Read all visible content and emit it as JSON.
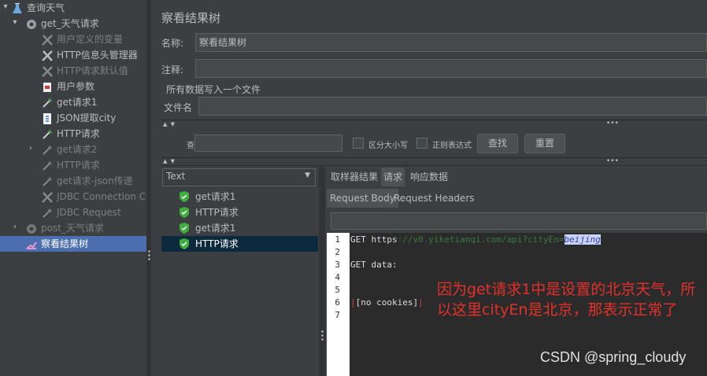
{
  "tree": {
    "items": [
      {
        "label": "查询天气",
        "icon": "flask-icon",
        "disabled": false
      },
      {
        "label": "get_天气请求",
        "icon": "gear-icon",
        "disabled": false
      },
      {
        "label": "用户定义的变量",
        "icon": "wrench-icon",
        "disabled": true
      },
      {
        "label": "HTTP信息头管理器",
        "icon": "wrench-icon",
        "disabled": false
      },
      {
        "label": "HTTP请求默认值",
        "icon": "wrench-icon",
        "disabled": true
      },
      {
        "label": "用户参数",
        "icon": "preprocessor-icon",
        "disabled": false
      },
      {
        "label": "get请求1",
        "icon": "pipette-icon",
        "disabled": false
      },
      {
        "label": "JSON提取city",
        "icon": "extractor-icon",
        "disabled": false
      },
      {
        "label": "HTTP请求",
        "icon": "pipette-icon",
        "disabled": false
      },
      {
        "label": "get请求2",
        "icon": "pipette-icon",
        "disabled": true
      },
      {
        "label": "HTTP请求",
        "icon": "pipette-icon",
        "disabled": true
      },
      {
        "label": "get请求-json传递",
        "icon": "pipette-icon",
        "disabled": true
      },
      {
        "label": "JDBC Connection Co",
        "icon": "wrench-icon",
        "disabled": true
      },
      {
        "label": "JDBC Request",
        "icon": "pipette-icon",
        "disabled": true
      },
      {
        "label": "post_天气请求",
        "icon": "gear-icon",
        "disabled": true
      },
      {
        "label": "察看结果树",
        "icon": "listener-icon",
        "disabled": false
      }
    ]
  },
  "panel": {
    "title": "察看结果树",
    "name_label": "名称:",
    "name_value": "察看结果树",
    "comment_label": "注释:",
    "comment_value": "",
    "write_all_label": "所有数据写入一个文件",
    "filename_label": "文件名",
    "filename_value": "",
    "search_label": "查找:",
    "search_value": "",
    "case_label": "区分大小写",
    "regex_label": "正则表达式",
    "search_button": "查找",
    "reset_button": "重置"
  },
  "results": {
    "renderer": "Text",
    "items": [
      {
        "label": "get请求1"
      },
      {
        "label": "HTTP请求"
      },
      {
        "label": "get请求1"
      },
      {
        "label": "HTTP请求"
      }
    ]
  },
  "tabs": {
    "top": [
      "取样器结果",
      "请求",
      "响应数据"
    ],
    "sub": [
      "Request Body",
      "Request Headers"
    ]
  },
  "code": {
    "line_numbers": [
      "1",
      "2",
      "3",
      "4",
      "5",
      "6",
      "7"
    ],
    "line1_prefix": "GET https",
    "line1_url": "://v0.yiketianqi.com/api?cityEn=",
    "line1_highlight": "beijing",
    "line3": "GET data:",
    "line6": "[no cookies]"
  },
  "annotation": "因为get请求1中是设置的北京天气，所以这里cityEn是北京，那表示正常了",
  "watermark": "CSDN @spring_cloudy",
  "colors": {
    "background": "#3c3f41",
    "selection": "#4b6eaf",
    "result_selected": "#0d293e",
    "success_green": "#3fae3f",
    "annotation_red": "#e5302a"
  }
}
